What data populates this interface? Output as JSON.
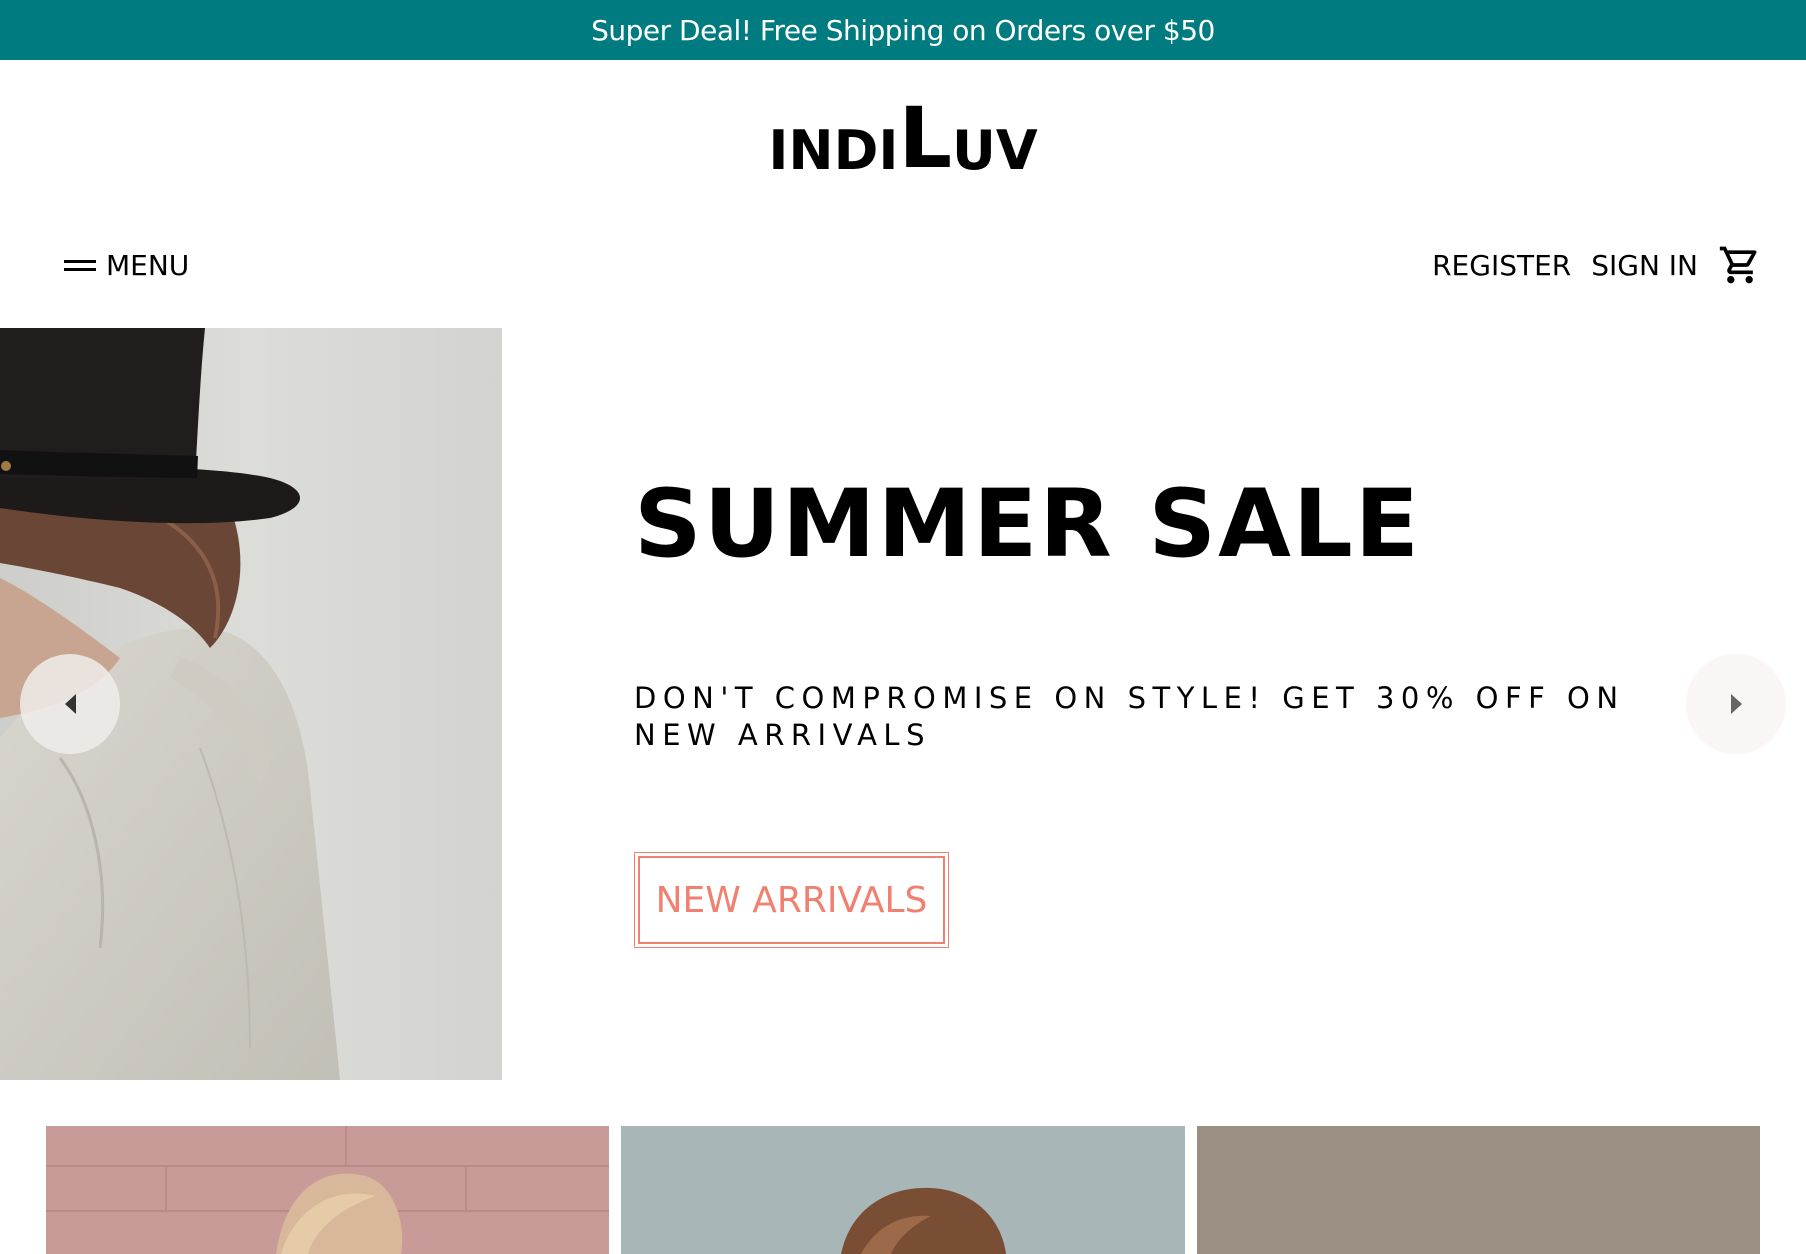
{
  "announcement": {
    "text": "Super Deal! Free Shipping on Orders over $50"
  },
  "logo": {
    "part1": "INDI",
    "part2": "L",
    "part3": "UV"
  },
  "nav": {
    "menu_label": "MENU",
    "register_label": "REGISTER",
    "signin_label": "SIGN IN",
    "cart_icon": "shopping-cart-icon"
  },
  "hero": {
    "title": "SUMMER SALE",
    "subtitle": "DON'T COMPROMISE ON STYLE! GET 30% OFF ON NEW ARRIVALS",
    "button_label": "NEW ARRIVALS",
    "prev_icon": "chevron-left-icon",
    "next_icon": "chevron-right-icon"
  },
  "colors": {
    "announcement_bg": "#007b80",
    "accent": "#f08070",
    "text": "#000000"
  }
}
